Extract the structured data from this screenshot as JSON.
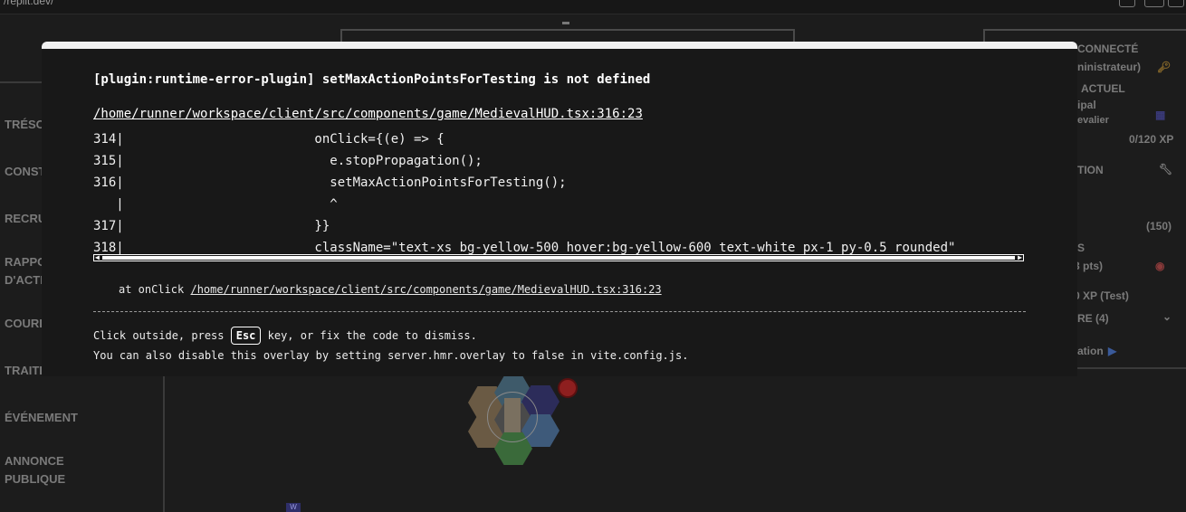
{
  "browser": {
    "url_fragment": "/replit.dev/"
  },
  "side_nav": [
    "TRÉSO",
    "CONST",
    "RECRU",
    "RAPPO",
    "D'ACTI",
    "COURI",
    "TRAITI",
    "ÉVÉNEMENT",
    "ANNONCE",
    "PUBLIQUE"
  ],
  "right_panel": {
    "connected": "CONNECTÉ",
    "role": "ninistrateur)",
    "current": "ACTUEL",
    "place": "ipal",
    "rank": "evalier",
    "xp": "0/120 XP",
    "section_tion": "TION",
    "points_total": "(150)",
    "s_label": "S",
    "pts": "3 pts)",
    "xp_test": "0 XP (Test)",
    "re_label": "RE (4)",
    "ation": "ation"
  },
  "overlay": {
    "message": "[plugin:runtime-error-plugin] setMaxActionPointsForTesting is not defined",
    "file": "/home/runner/workspace/client/src/components/game/MedievalHUD.tsx:316:23",
    "code_lines": [
      "314|                         onClick={(e) => {",
      "315|                           e.stopPropagation();",
      "316|                           setMaxActionPointsForTesting();",
      "   |                           ^",
      "317|                         }}",
      "318|                         className=\"text-xs bg-yellow-500 hover:bg-yellow-600 text-white px-1 py-0.5 rounded\""
    ],
    "stack_prefix": "at onClick ",
    "stack_link": "/home/runner/workspace/client/src/components/game/MedievalHUD.tsx:316:23",
    "tip_before": "Click outside, press ",
    "tip_key": "Esc",
    "tip_after": " key, or fix the code to dismiss.",
    "tip2": "You can also disable this overlay by setting server.hmr.overlay to false in vite.config.js."
  },
  "colors": {
    "overlay_bg": "#181818",
    "overlay_border": "#f1f1f1",
    "app_bg": "#1c1c1c"
  }
}
